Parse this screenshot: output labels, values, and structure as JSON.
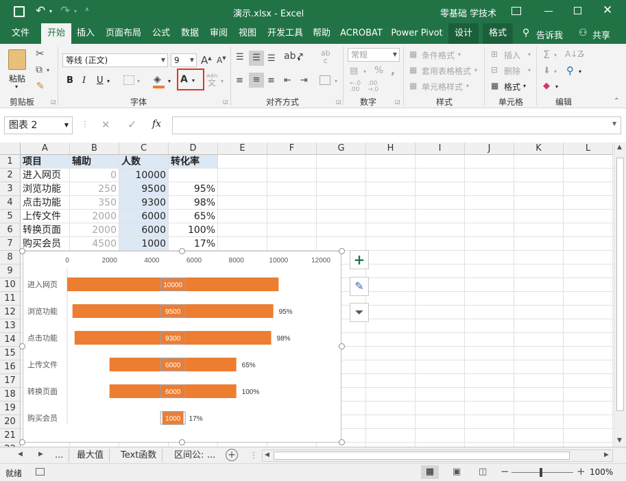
{
  "titlebar": {
    "doc_title": "演示.xlsx  -  Excel",
    "account": "零基础 学技术"
  },
  "tabs": [
    "文件",
    "开始",
    "插入",
    "页面布局",
    "公式",
    "数据",
    "审阅",
    "视图",
    "开发工具",
    "帮助",
    "ACROBAT",
    "Power Pivot",
    "设计",
    "格式"
  ],
  "tellme": "告诉我",
  "share": "共享",
  "ribbon": {
    "clipboard": {
      "paste": "粘贴",
      "group": "剪贴板"
    },
    "font": {
      "name": "等线 (正文)",
      "size": "9",
      "bold": "B",
      "italic": "I",
      "underline": "U",
      "font_color": "A",
      "wen": "wén",
      "wen2": "文",
      "group": "字体"
    },
    "align": {
      "group": "对齐方式"
    },
    "number": {
      "format": "常规",
      "percent": "%",
      "comma": ",",
      "group": "数字",
      "ab": "ab",
      "ab2": "c"
    },
    "styles": {
      "cond": "条件格式",
      "table": "套用表格格式",
      "cell": "单元格样式",
      "group": "样式"
    },
    "cells": {
      "insert": "插入",
      "delete": "删除",
      "format": "格式",
      "group": "单元格"
    },
    "edit": {
      "group": "编辑"
    }
  },
  "formula": {
    "namebox": "图表 2",
    "fx": "fx",
    "value": ""
  },
  "columns": [
    "A",
    "B",
    "C",
    "D",
    "E",
    "F",
    "G",
    "H",
    "I",
    "J",
    "K",
    "L"
  ],
  "rows": [
    "1",
    "2",
    "3",
    "4",
    "5",
    "6",
    "7",
    "8",
    "9",
    "10",
    "11",
    "12",
    "13",
    "14",
    "15",
    "16",
    "17",
    "18",
    "19",
    "20",
    "21",
    "22"
  ],
  "table": {
    "headers": [
      "项目",
      "辅助",
      "人数",
      "转化率"
    ],
    "data": [
      [
        "进入网页",
        "0",
        "10000",
        ""
      ],
      [
        "浏览功能",
        "250",
        "9500",
        "95%"
      ],
      [
        "点击功能",
        "350",
        "9300",
        "98%"
      ],
      [
        "上传文件",
        "2000",
        "6000",
        "65%"
      ],
      [
        "转换页面",
        "2000",
        "6000",
        "100%"
      ],
      [
        "购买会员",
        "4500",
        "1000",
        "17%"
      ]
    ]
  },
  "chart_data": {
    "type": "bar",
    "categories": [
      "进入网页",
      "浏览功能",
      "点击功能",
      "上传文件",
      "转换页面",
      "购买会员"
    ],
    "series": [
      {
        "values": [
          0,
          250,
          350,
          2000,
          2000,
          4500
        ]
      },
      {
        "values": [
          10000,
          9500,
          9300,
          6000,
          6000,
          1000
        ]
      }
    ],
    "data_labels": [
      "10000",
      "9500",
      "9300",
      "6000",
      "6000",
      "1000"
    ],
    "rate_labels": [
      "",
      "95%",
      "98%",
      "65%",
      "100%",
      "17%"
    ],
    "xlim": [
      0,
      12000
    ],
    "xticks": [
      "0",
      "2000",
      "4000",
      "6000",
      "8000",
      "10000",
      "12000"
    ],
    "bar_color": "#ed7d31",
    "stacked": true,
    "axis_position": "top"
  },
  "sheets": [
    "...",
    "最大值",
    "Text函数",
    "区间公:",
    "..."
  ],
  "status": {
    "ready": "就绪",
    "zoom": "100%"
  },
  "colors": {
    "excel_green": "#217346",
    "highlight": "#dde8f5",
    "selection_red": "#e03030"
  }
}
